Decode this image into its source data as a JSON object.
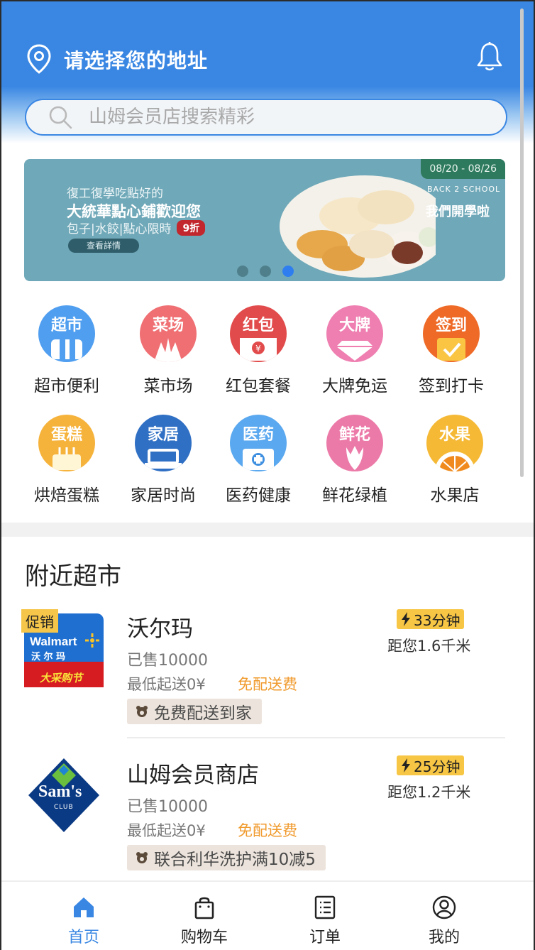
{
  "header": {
    "address_prompt": "请选择您的地址",
    "search_placeholder": "山姆会员店搜索精彩",
    "brand_color": "#3a87e3"
  },
  "banner": {
    "date_range": "08/20 - 08/26",
    "line1": "復工復學吃點好的",
    "line2": "大統華點心鋪歡迎您",
    "line3": "包子|水餃|點心限時",
    "discount_badge": "9折",
    "button_label": "查看詳情",
    "slogan_en": "BACK 2 SCHOOL",
    "slogan_cn": "我們開學啦",
    "dots": 3,
    "active_dot": 3
  },
  "categories": [
    {
      "icon_text": "超市",
      "label": "超市便利",
      "color": "#4f9ef0",
      "icon": "supermarket-icon"
    },
    {
      "icon_text": "菜场",
      "label": "菜市场",
      "color": "#ef6f73",
      "icon": "vegetable-market-icon"
    },
    {
      "icon_text": "红包",
      "label": "红包套餐",
      "color": "#e24b4b",
      "icon": "red-envelope-icon"
    },
    {
      "icon_text": "大牌",
      "label": "大牌免运",
      "color": "#ee7fb0",
      "icon": "diamond-icon"
    },
    {
      "icon_text": "签到",
      "label": "签到打卡",
      "color": "#ee6a26",
      "icon": "calendar-check-icon"
    },
    {
      "icon_text": "蛋糕",
      "label": "烘焙蛋糕",
      "color": "#f6b33c",
      "icon": "cake-icon"
    },
    {
      "icon_text": "家居",
      "label": "家居时尚",
      "color": "#2f6fc4",
      "icon": "sofa-icon"
    },
    {
      "icon_text": "医药",
      "label": "医药健康",
      "color": "#5aa8ef",
      "icon": "medical-kit-icon"
    },
    {
      "icon_text": "鲜花",
      "label": "鲜花绿植",
      "color": "#ec7aa8",
      "icon": "flower-icon"
    },
    {
      "icon_text": "水果",
      "label": "水果店",
      "color": "#f5b936",
      "icon": "orange-slice-icon"
    }
  ],
  "nearby": {
    "title": "附近超市",
    "stores": [
      {
        "name": "沃尔玛",
        "promo_tag": "促销",
        "logo_text": "Walmart",
        "logo_sub": "沃 尔 玛",
        "logo_banner": "大采购节",
        "sold": "已售10000",
        "min_fee": "最低起送0¥",
        "free_delivery": "免配送费",
        "tag": "免费配送到家",
        "time": "33分钟",
        "distance": "距您1.6千米"
      },
      {
        "name": "山姆会员商店",
        "logo_text": "Sam's",
        "logo_sub": "CLUB",
        "sold": "已售10000",
        "min_fee": "最低起送0¥",
        "free_delivery": "免配送费",
        "tag": "联合利华洗护满10减5",
        "time": "25分钟",
        "distance": "距您1.2千米"
      }
    ]
  },
  "tabbar": {
    "items": [
      {
        "label": "首页",
        "icon": "home-icon",
        "active": true
      },
      {
        "label": "购物车",
        "icon": "shopping-bag-icon",
        "active": false
      },
      {
        "label": "订单",
        "icon": "order-list-icon",
        "active": false
      },
      {
        "label": "我的",
        "icon": "profile-icon",
        "active": false
      }
    ]
  }
}
